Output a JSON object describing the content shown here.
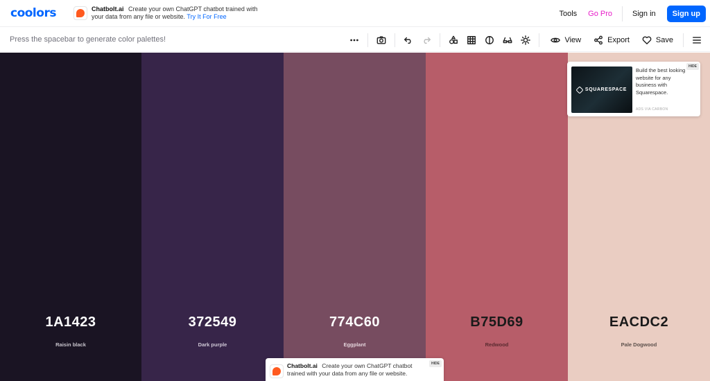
{
  "header": {
    "logo": "coolors",
    "promo": {
      "brand": "Chatbolt.ai",
      "text": "Create your own ChatGPT chatbot trained with your data from any file or website.",
      "cta": "Try It For Free"
    },
    "nav": {
      "tools": "Tools",
      "go_pro": "Go Pro",
      "sign_in": "Sign in",
      "sign_up": "Sign up"
    }
  },
  "toolbar": {
    "hint": "Press the spacebar to generate color palettes!",
    "icons": [
      "more-icon",
      "camera-icon",
      "undo-icon",
      "redo-icon",
      "shapes-icon",
      "grid-icon",
      "contrast-icon",
      "glasses-icon",
      "sun-icon"
    ],
    "view_label": "View",
    "export_label": "Export",
    "save_label": "Save"
  },
  "palette": [
    {
      "hex": "1A1423",
      "name": "Raisin black",
      "color": "#1A1423",
      "text_color": "#ffffff",
      "name_color": "#c8c4cc"
    },
    {
      "hex": "372549",
      "name": "Dark purple",
      "color": "#372549",
      "text_color": "#ffffff",
      "name_color": "#cfc8d6"
    },
    {
      "hex": "774C60",
      "name": "Eggplant",
      "color": "#774C60",
      "text_color": "#ffffff",
      "name_color": "#e3d3da"
    },
    {
      "hex": "B75D69",
      "name": "Redwood",
      "color": "#B75D69",
      "text_color": "#1a1a1a",
      "name_color": "#5a2a30"
    },
    {
      "hex": "EACDC2",
      "name": "Pale Dogwood",
      "color": "#EACDC2",
      "text_color": "#1a1a1a",
      "name_color": "#5d514c"
    }
  ],
  "ad": {
    "image_label": "SQUARESPACE",
    "text": "Build the best looking website for any business with Squarespace.",
    "via": "ADS VIA CARBON",
    "hide": "HIDE"
  },
  "bottom_promo": {
    "brand": "Chatbolt.ai",
    "text": "Create your own ChatGPT chatbot trained with your data from any file or website.",
    "hide": "HIDE"
  }
}
